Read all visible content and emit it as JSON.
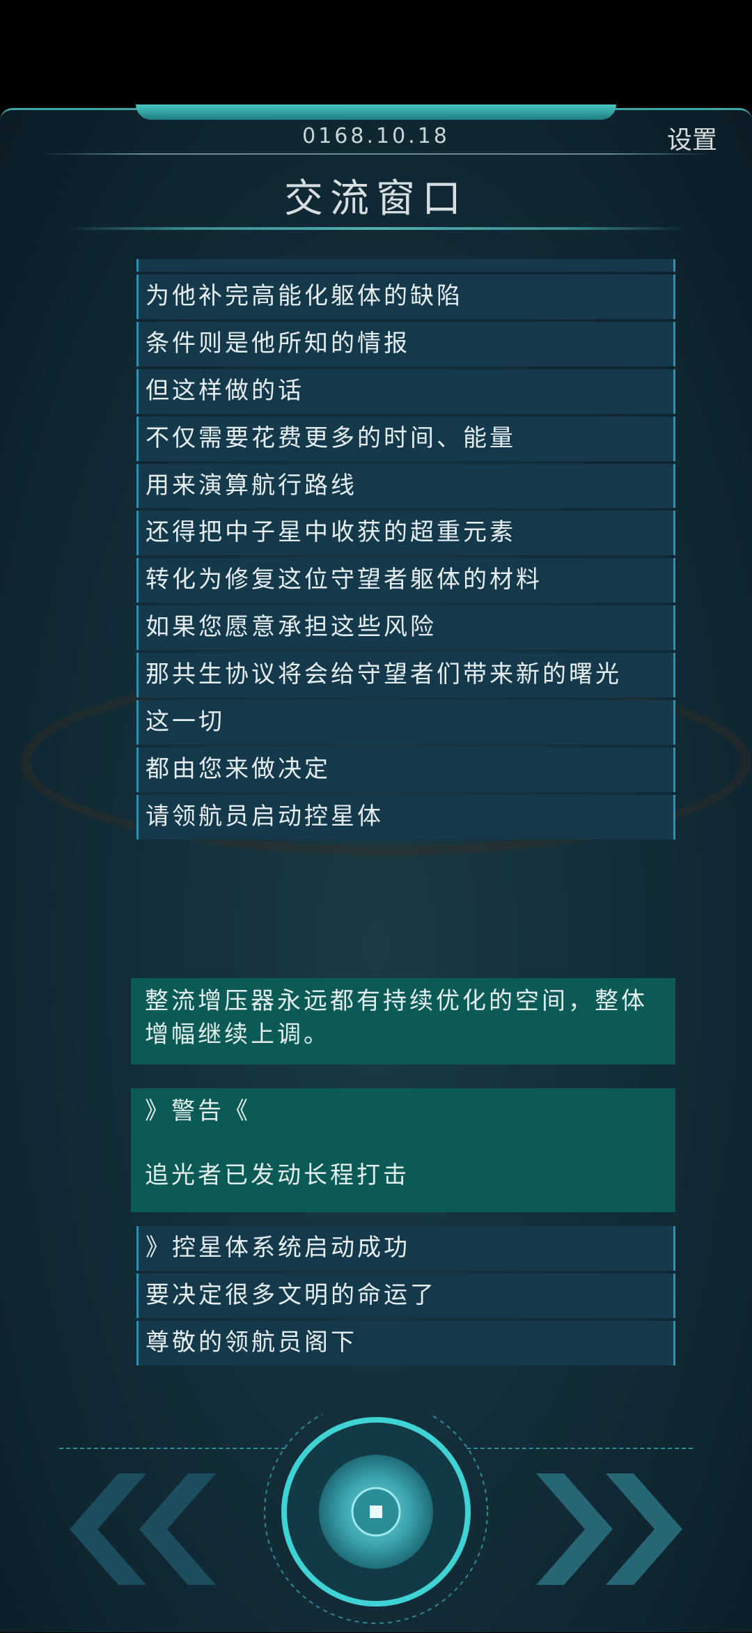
{
  "header": {
    "date": "0168.10.18",
    "settings_label": "设置",
    "title": "交流窗口"
  },
  "messages": [
    "为他补完高能化躯体的缺陷",
    "条件则是他所知的情报",
    "但这样做的话",
    "不仅需要花费更多的时间、能量",
    "用来演算航行路线",
    "还得把中子星中收获的超重元素",
    "转化为修复这位守望者躯体的材料",
    "如果您愿意承担这些风险",
    "那共生协议将会给守望者们带来新的曙光",
    "这一切",
    "都由您来做决定",
    "请领航员启动控星体"
  ],
  "notices": {
    "upgrade": "整流增压器永远都有持续优化的空间，整体增幅继续上调。",
    "warning_title": "》警告《",
    "warning_body": "追光者已发动长程打击"
  },
  "messages_bottom": [
    "》控星体系统启动成功",
    "要决定很多文明的命运了",
    "尊敬的领航员阁下"
  ],
  "controls": {
    "back_icon": "double-chevron-left-icon",
    "center_icon": "core-button-icon",
    "forward_icon": "double-chevron-right-icon"
  },
  "colors": {
    "accent": "#3ad1d1",
    "panel": "#14394b",
    "notice": "#0c5a55"
  }
}
